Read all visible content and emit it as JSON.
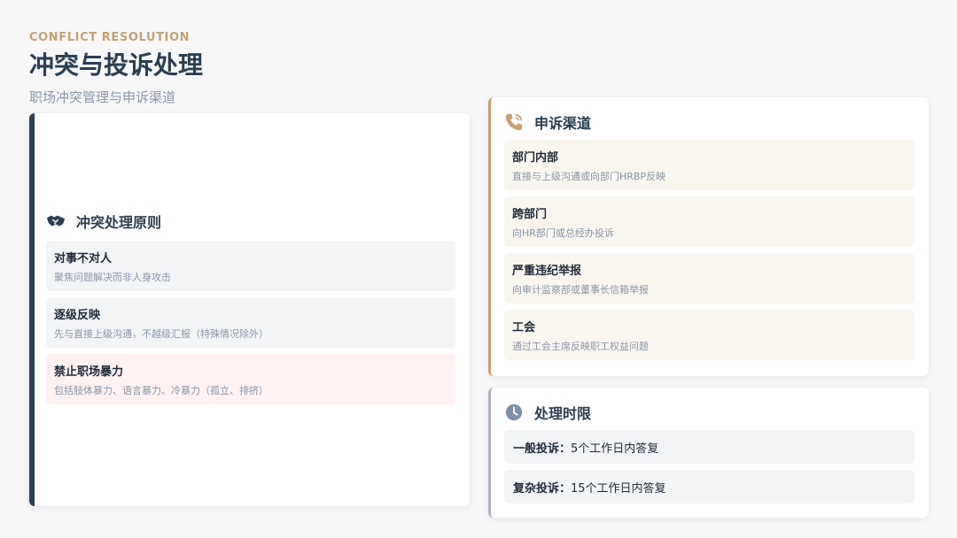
{
  "header": {
    "eyebrow": "CONFLICT RESOLUTION",
    "title": "冲突与投诉处理",
    "subtitle": "职场冲突管理与申诉渠道"
  },
  "principles": {
    "title": "冲突处理原则",
    "icon": "handshake-icon",
    "items": [
      {
        "title": "对事不对人",
        "desc": "聚焦问题解决而非人身攻击"
      },
      {
        "title": "逐级反映",
        "desc": "先与直接上级沟通，不越级汇报（特殊情况除外）"
      },
      {
        "title": "禁止职场暴力",
        "desc": "包括肢体暴力、语言暴力、冷暴力（孤立、排挤）"
      }
    ]
  },
  "appeal": {
    "title": "申诉渠道",
    "icon": "phone-icon",
    "items": [
      {
        "title": "部门内部",
        "desc": "直接与上级沟通或向部门HRBP反映"
      },
      {
        "title": "跨部门",
        "desc": "向HR部门或总经办投诉"
      },
      {
        "title": "严重违纪举报",
        "desc": "向审计监察部或董事长信箱举报"
      },
      {
        "title": "工会",
        "desc": "通过工会主席反映职工权益问题"
      }
    ]
  },
  "timelimit": {
    "title": "处理时限",
    "icon": "clock-icon",
    "rows": [
      {
        "key": "一般投诉：",
        "value": "5个工作日内答复"
      },
      {
        "key": "复杂投诉：",
        "value": "15个工作日内答复"
      }
    ]
  },
  "colors": {
    "navy": "#2c3e50",
    "gold": "#c3a173",
    "muted": "#8a96a6"
  }
}
